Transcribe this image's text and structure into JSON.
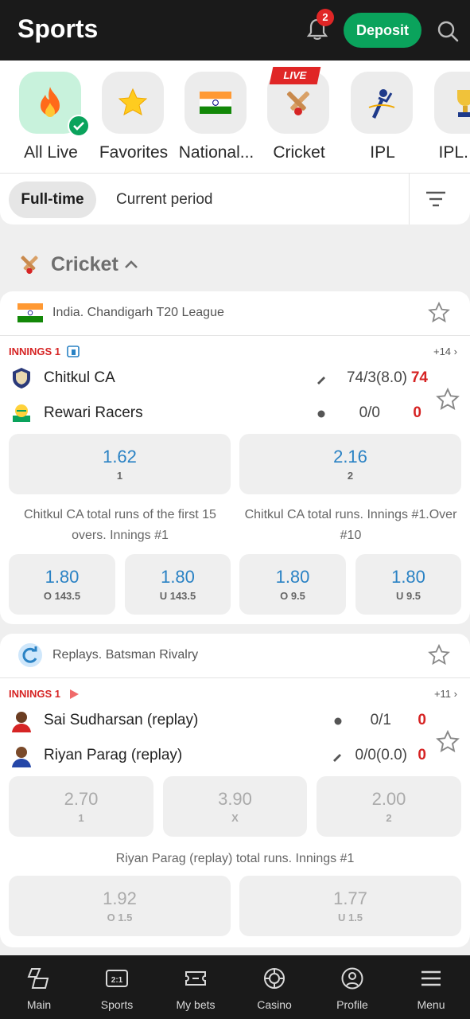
{
  "header": {
    "title": "Sports",
    "notifications": "2",
    "deposit_label": "Deposit"
  },
  "categories": [
    {
      "label": "All Live",
      "icon": "fire-icon",
      "active": true
    },
    {
      "label": "Favorites",
      "icon": "star-icon"
    },
    {
      "label": "National...",
      "icon": "india-flag-icon"
    },
    {
      "label": "Cricket",
      "icon": "cricket-icon",
      "badge": "LIVE"
    },
    {
      "label": "IPL",
      "icon": "ipl-logo-icon"
    },
    {
      "label": "IPL. Sp",
      "icon": "ipl-trophy-icon"
    }
  ],
  "period_tabs": {
    "full_time": "Full-time",
    "current": "Current period"
  },
  "section": {
    "title": "Cricket"
  },
  "events": [
    {
      "league": "India. Chandigarh T20 League",
      "status": "INNINGS 1",
      "more": "+14",
      "teams": [
        {
          "name": "Chitkul CA",
          "detail": "74/3(8.0)",
          "score": "74",
          "batting": true
        },
        {
          "name": "Rewari Racers",
          "detail": "0/0",
          "score": "0",
          "batting": false
        }
      ],
      "main_odds": [
        {
          "value": "1.62",
          "label": "1"
        },
        {
          "value": "2.16",
          "label": "2"
        }
      ],
      "markets": [
        {
          "title": "Chitkul CA total runs of the first 15 overs. Innings #1",
          "odds": [
            {
              "value": "1.80",
              "label": "O 143.5"
            },
            {
              "value": "1.80",
              "label": "U 143.5"
            }
          ]
        },
        {
          "title": "Chitkul CA total runs. Innings #1.Over #10",
          "odds": [
            {
              "value": "1.80",
              "label": "O 9.5"
            },
            {
              "value": "1.80",
              "label": "U 9.5"
            }
          ]
        }
      ]
    },
    {
      "league": "Replays. Batsman Rivalry",
      "status": "INNINGS 1",
      "more": "+11",
      "teams": [
        {
          "name": "Sai Sudharsan (replay)",
          "detail": "0/1",
          "score": "0",
          "batting": false
        },
        {
          "name": "Riyan Parag (replay)",
          "detail": "0/0(0.0)",
          "score": "0",
          "batting": true
        }
      ],
      "main_odds": [
        {
          "value": "2.70",
          "label": "1"
        },
        {
          "value": "3.90",
          "label": "X"
        },
        {
          "value": "2.00",
          "label": "2"
        }
      ],
      "markets": [
        {
          "title": "Riyan Parag (replay) total runs. Innings #1",
          "odds": [
            {
              "value": "1.92",
              "label": "O 1.5"
            },
            {
              "value": "1.77",
              "label": "U 1.5"
            }
          ]
        }
      ]
    }
  ],
  "nav": [
    {
      "label": "Main",
      "icon": "main-icon"
    },
    {
      "label": "Sports",
      "icon": "scoreboard-icon"
    },
    {
      "label": "My bets",
      "icon": "ticket-icon"
    },
    {
      "label": "Casino",
      "icon": "chip-icon"
    },
    {
      "label": "Profile",
      "icon": "profile-icon"
    },
    {
      "label": "Menu",
      "icon": "menu-icon"
    }
  ],
  "colors": {
    "accent_green": "#0aa35c",
    "odds_blue": "#2a82c4",
    "live_red": "#d62424",
    "header_bg": "#1a1a1a"
  }
}
